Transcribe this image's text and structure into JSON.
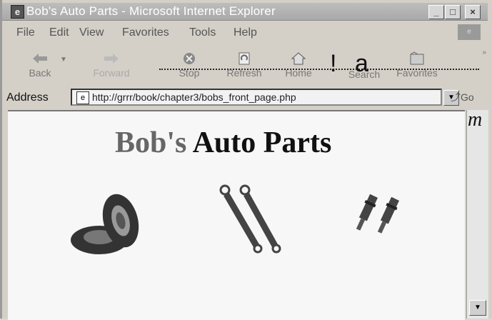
{
  "window": {
    "title": "Bob's Auto Parts - Microsoft Internet Explorer",
    "controls": {
      "minimize": "_",
      "maximize": "□",
      "close": "×"
    }
  },
  "menu": {
    "file": "File",
    "edit": "Edit",
    "view": "View",
    "favorites": "Favorites",
    "tools": "Tools",
    "help": "Help"
  },
  "toolbar": {
    "back": "Back",
    "forward": "Forward",
    "stop": "Stop",
    "refresh": "Refresh",
    "home": "Home",
    "search": "Search",
    "favorites": "Favorites",
    "glyph_excl": "!",
    "glyph_a": "a"
  },
  "address": {
    "label": "Address",
    "url": "http://grrr/book/chapter3/bobs_front_page.php",
    "go": "Go"
  },
  "page": {
    "heading_part1": "Bob's",
    "heading_part2": "Auto Parts",
    "corner_mark": "m"
  },
  "images": [
    "tires-icon",
    "shock-absorbers-icon",
    "spark-plugs-icon"
  ]
}
